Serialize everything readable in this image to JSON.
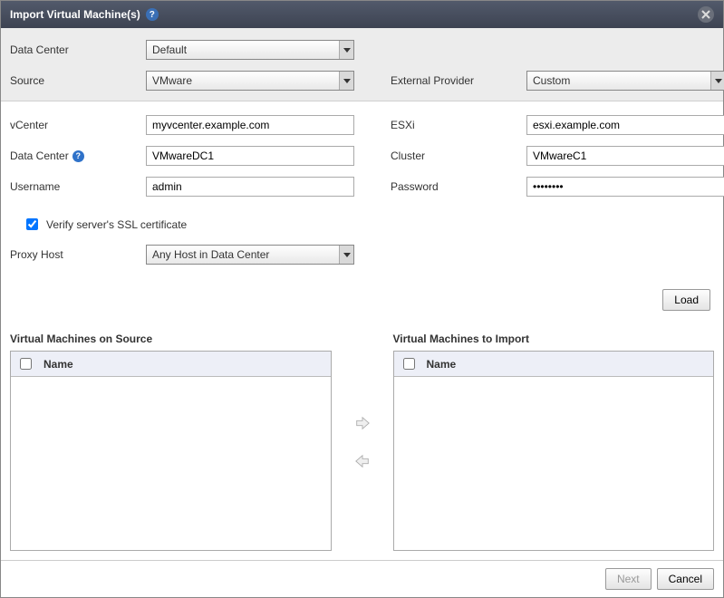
{
  "title": "Import Virtual Machine(s)",
  "topForm": {
    "dataCenter": {
      "label": "Data Center",
      "value": "Default"
    },
    "source": {
      "label": "Source",
      "value": "VMware"
    },
    "externalProvider": {
      "label": "External Provider",
      "value": "Custom"
    }
  },
  "connForm": {
    "vcenter": {
      "label": "vCenter",
      "value": "myvcenter.example.com"
    },
    "esxi": {
      "label": "ESXi",
      "value": "esxi.example.com"
    },
    "dataCenter": {
      "label": "Data Center",
      "value": "VMwareDC1"
    },
    "cluster": {
      "label": "Cluster",
      "value": "VMwareC1"
    },
    "username": {
      "label": "Username",
      "value": "admin"
    },
    "password": {
      "label": "Password",
      "value": "••••••••"
    },
    "verifySsl": {
      "label": "Verify server's SSL certificate",
      "checked": true
    },
    "proxyHost": {
      "label": "Proxy Host",
      "value": "Any Host in Data Center"
    }
  },
  "buttons": {
    "load": "Load",
    "next": "Next",
    "cancel": "Cancel"
  },
  "transfer": {
    "sourceTitle": "Virtual Machines on Source",
    "targetTitle": "Virtual Machines to Import",
    "columnName": "Name"
  }
}
